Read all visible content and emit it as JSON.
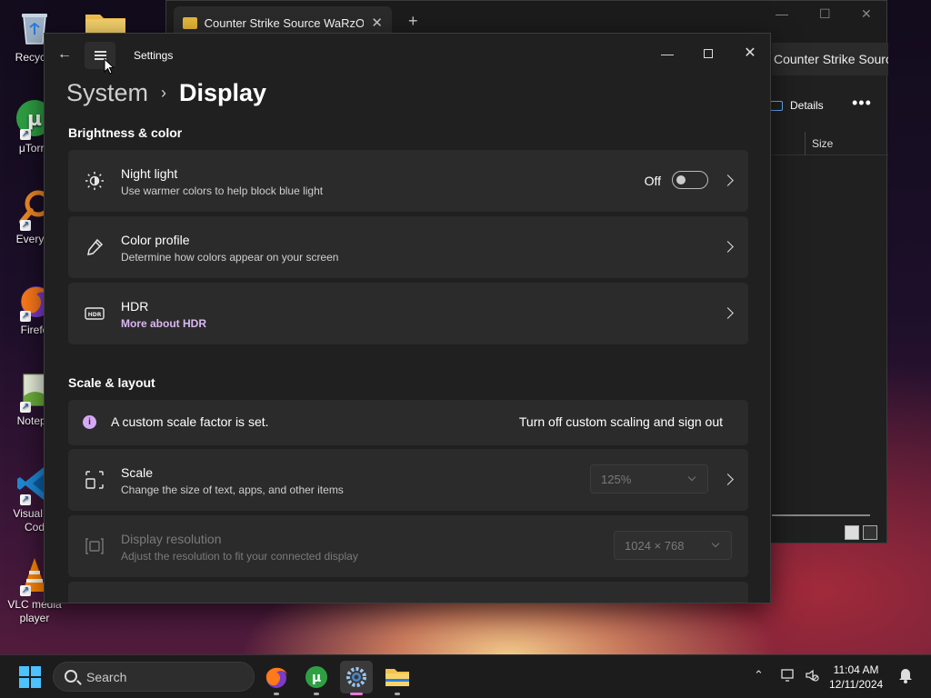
{
  "desktop": {
    "icons": [
      {
        "name": "recycle-bin",
        "label": "Recycle"
      },
      {
        "name": "utorrent",
        "label": "μTorre"
      },
      {
        "name": "everything",
        "label": "Everyth"
      },
      {
        "name": "firefox",
        "label": "Firefo"
      },
      {
        "name": "notepad",
        "label": "Notepa"
      },
      {
        "name": "vscode",
        "label": "Visual St\nCod"
      },
      {
        "name": "vlc",
        "label": "VLC media\nplayer"
      }
    ]
  },
  "explorer": {
    "tab_title": "Counter Strike Source WaRzOr",
    "new_tab": "+",
    "address": "Counter Strike Sourc",
    "details_label": "Details",
    "more": "•••",
    "column_size": "Size"
  },
  "settings": {
    "app_title": "Settings",
    "breadcrumb": {
      "parent": "System",
      "separator": "›",
      "current": "Display"
    },
    "sections": {
      "brightness": "Brightness & color",
      "scale": "Scale & layout"
    },
    "night_light": {
      "title": "Night light",
      "subtitle": "Use warmer colors to help block blue light",
      "state": "Off"
    },
    "color_profile": {
      "title": "Color profile",
      "subtitle": "Determine how colors appear on your screen"
    },
    "hdr": {
      "title": "HDR",
      "subtitle": "More about HDR"
    },
    "custom_scale": {
      "message": "A custom scale factor is set.",
      "action": "Turn off custom scaling and sign out"
    },
    "scale": {
      "title": "Scale",
      "subtitle": "Change the size of text, apps, and other items",
      "value": "125%"
    },
    "resolution": {
      "title": "Display resolution",
      "subtitle": "Adjust the resolution to fit your connected display",
      "value": "1024 × 768"
    }
  },
  "taskbar": {
    "search_placeholder": "Search",
    "time": "11:04 AM",
    "date": "12/11/2024"
  },
  "colors": {
    "accent": "#4cc2ff",
    "info": "#d7a8f5",
    "active_indicator": "#e77ad6"
  }
}
